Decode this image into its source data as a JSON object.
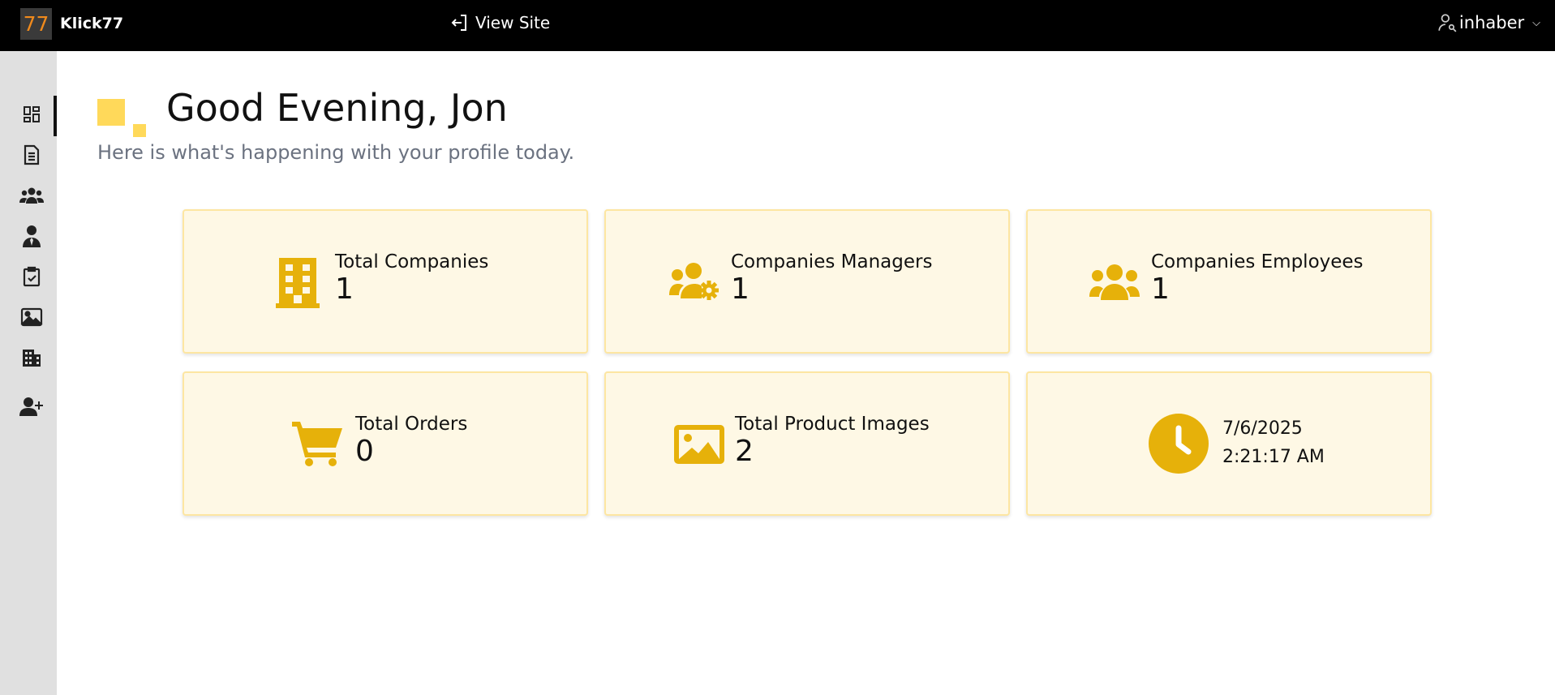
{
  "brand": {
    "logo_text": "77",
    "name": "Klick77"
  },
  "topbar": {
    "view_site_label": "View Site",
    "user_name": "inhaber"
  },
  "sidebar": {
    "items": [
      {
        "icon": "dashboard-icon",
        "active": true
      },
      {
        "icon": "document-icon"
      },
      {
        "icon": "users-group-icon"
      },
      {
        "icon": "manager-icon"
      },
      {
        "icon": "clipboard-check-icon"
      },
      {
        "icon": "image-icon"
      },
      {
        "icon": "building-icon"
      },
      {
        "icon": "user-add-icon"
      }
    ]
  },
  "header": {
    "greeting": "Good Evening, Jon",
    "subtitle": "Here is what's happening with your profile today."
  },
  "stats": [
    {
      "label": "Total Companies",
      "value": "1",
      "icon": "building-icon"
    },
    {
      "label": "Companies Managers",
      "value": "1",
      "icon": "users-cog-icon"
    },
    {
      "label": "Companies Employees",
      "value": "1",
      "icon": "users-icon"
    },
    {
      "label": "Total Orders",
      "value": "0",
      "icon": "cart-icon"
    },
    {
      "label": "Total Product Images",
      "value": "2",
      "icon": "image-icon"
    }
  ],
  "clock": {
    "date": "7/6/2025",
    "time": "2:21:17 AM",
    "icon": "clock-icon"
  },
  "colors": {
    "accent": "#e6b10a",
    "card_bg": "#fef8e5",
    "card_border": "#fde6a2",
    "deco": "#ffd95a",
    "sidebar_bg": "#e0e0e0"
  }
}
